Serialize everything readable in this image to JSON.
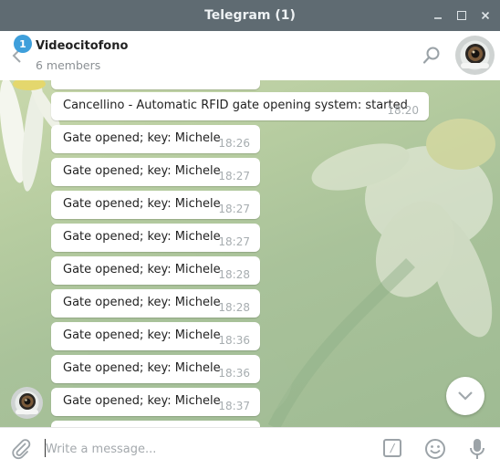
{
  "window": {
    "title": "Telegram (1)"
  },
  "header": {
    "unread_badge": "1",
    "chat_name": "Videocitofono",
    "chat_subtitle": "6 members"
  },
  "messages": [
    {
      "text": "Cancellino - Automatic RFID gate opening system: started",
      "time": "18:20"
    },
    {
      "text": "Gate opened; key: Michele",
      "time": "18:26"
    },
    {
      "text": "Gate opened; key: Michele",
      "time": "18:27"
    },
    {
      "text": "Gate opened; key: Michele",
      "time": "18:27"
    },
    {
      "text": "Gate opened; key: Michele",
      "time": "18:27"
    },
    {
      "text": "Gate opened; key: Michele",
      "time": "18:28"
    },
    {
      "text": "Gate opened; key: Michele",
      "time": "18:28"
    },
    {
      "text": "Gate opened; key: Michele",
      "time": "18:36"
    },
    {
      "text": "Gate opened; key: Michele",
      "time": "18:36"
    },
    {
      "text": "Gate opened; key: Michele",
      "time": "18:37"
    }
  ],
  "composer": {
    "placeholder": "Write a message...",
    "command_glyph": "/"
  },
  "icons": {
    "minimize": "minimize-icon",
    "maximize": "maximize-icon",
    "close": "close-icon",
    "back": "back-arrow-icon",
    "search": "search-icon",
    "attach": "paperclip-icon",
    "commands": "bot-command-icon",
    "emoji": "emoji-icon",
    "mic": "microphone-icon",
    "scroll_down": "chevron-down-icon"
  },
  "colors": {
    "titlebar": "#5f6b72",
    "badge": "#3e9fdb",
    "bubble": "#ffffff",
    "timestamp": "#a7adb0"
  }
}
